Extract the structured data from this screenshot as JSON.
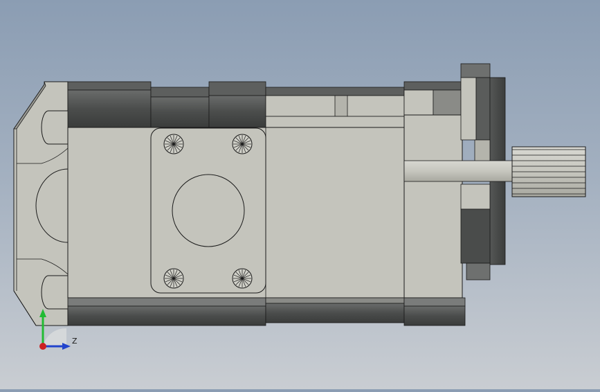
{
  "viewport": {
    "background_top": "#8b9db3",
    "background_bottom": "#c9cdd2",
    "model_face_color": "#c4c4bc",
    "model_shadow_color": "#4a4c4b",
    "edge_color": "#1a1a1a"
  },
  "triad": {
    "x_axis_color": "#cc2222",
    "y_axis_color": "#22bb33",
    "z_axis_color": "#2244cc",
    "z_label": "Z"
  }
}
